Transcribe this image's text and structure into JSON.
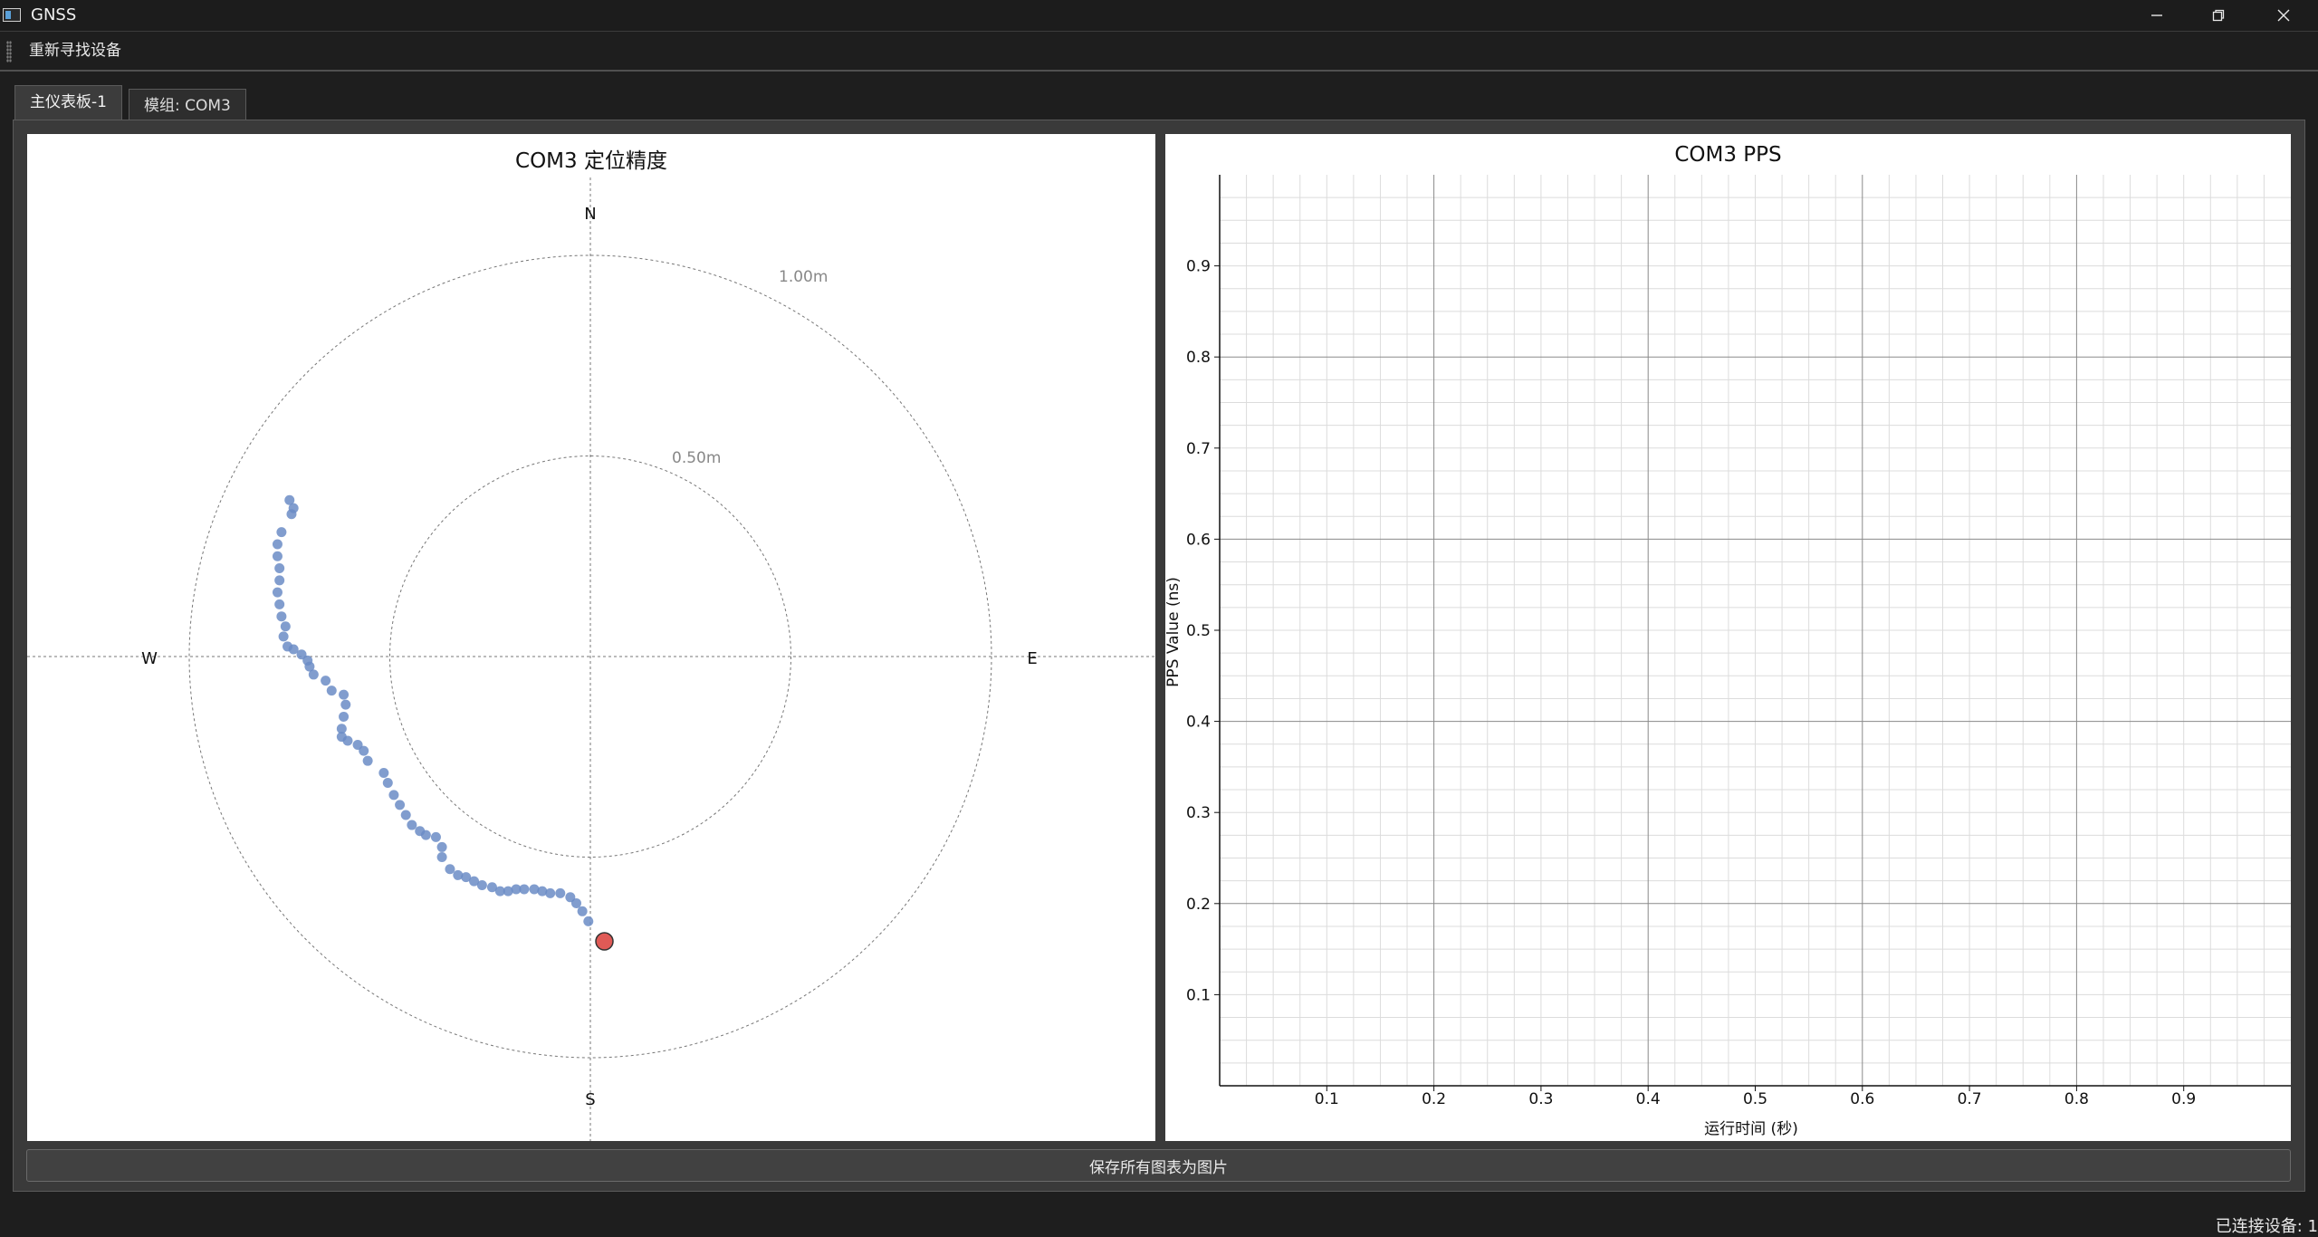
{
  "window": {
    "title": "GNSS"
  },
  "toolbar": {
    "rescan_label": "重新寻找设备"
  },
  "tabs": [
    {
      "label": "主仪表板-1",
      "active": true
    },
    {
      "label": "模组: COM3",
      "active": false
    }
  ],
  "polar_chart": {
    "title": "COM3 定位精度",
    "compass": {
      "n": "N",
      "s": "S",
      "e": "E",
      "w": "W"
    },
    "ring_labels": [
      "0.50m",
      "1.00m"
    ],
    "colors": {
      "track": "#6b8cc5",
      "current": "#e05a56"
    }
  },
  "chart_data": [
    {
      "type": "scatter",
      "title": "COM3 定位精度",
      "units": "m",
      "rings": [
        0.5,
        1.0
      ],
      "ring_labels": [
        "0.50m",
        "1.00m"
      ],
      "points_east_north": [
        [
          -0.75,
          0.39
        ],
        [
          -0.74,
          0.37
        ],
        [
          -0.745,
          0.355
        ],
        [
          -0.77,
          0.31
        ],
        [
          -0.78,
          0.28
        ],
        [
          -0.78,
          0.25
        ],
        [
          -0.775,
          0.22
        ],
        [
          -0.775,
          0.19
        ],
        [
          -0.78,
          0.16
        ],
        [
          -0.775,
          0.13
        ],
        [
          -0.77,
          0.1
        ],
        [
          -0.76,
          0.075
        ],
        [
          -0.765,
          0.05
        ],
        [
          -0.755,
          0.025
        ],
        [
          -0.74,
          0.018
        ],
        [
          -0.72,
          0.005
        ],
        [
          -0.705,
          -0.01
        ],
        [
          -0.7,
          -0.025
        ],
        [
          -0.69,
          -0.045
        ],
        [
          -0.66,
          -0.06
        ],
        [
          -0.645,
          -0.085
        ],
        [
          -0.615,
          -0.095
        ],
        [
          -0.61,
          -0.12
        ],
        [
          -0.615,
          -0.15
        ],
        [
          -0.62,
          -0.18
        ],
        [
          -0.62,
          -0.2
        ],
        [
          -0.605,
          -0.21
        ],
        [
          -0.58,
          -0.22
        ],
        [
          -0.565,
          -0.235
        ],
        [
          -0.555,
          -0.26
        ],
        [
          -0.515,
          -0.29
        ],
        [
          -0.505,
          -0.315
        ],
        [
          -0.49,
          -0.345
        ],
        [
          -0.475,
          -0.37
        ],
        [
          -0.46,
          -0.395
        ],
        [
          -0.445,
          -0.42
        ],
        [
          -0.425,
          -0.435
        ],
        [
          -0.41,
          -0.445
        ],
        [
          -0.385,
          -0.45
        ],
        [
          -0.37,
          -0.475
        ],
        [
          -0.37,
          -0.5
        ],
        [
          -0.35,
          -0.53
        ],
        [
          -0.33,
          -0.545
        ],
        [
          -0.31,
          -0.55
        ],
        [
          -0.29,
          -0.56
        ],
        [
          -0.27,
          -0.57
        ],
        [
          -0.245,
          -0.575
        ],
        [
          -0.225,
          -0.585
        ],
        [
          -0.205,
          -0.585
        ],
        [
          -0.185,
          -0.58
        ],
        [
          -0.165,
          -0.58
        ],
        [
          -0.14,
          -0.58
        ],
        [
          -0.12,
          -0.585
        ],
        [
          -0.1,
          -0.59
        ],
        [
          -0.075,
          -0.59
        ],
        [
          -0.05,
          -0.6
        ],
        [
          -0.035,
          -0.615
        ],
        [
          -0.02,
          -0.635
        ],
        [
          -0.005,
          -0.66
        ]
      ],
      "current": [
        0.035,
        -0.71
      ]
    },
    {
      "type": "line",
      "title": "COM3 PPS",
      "xlabel": "运行时间 (秒)",
      "ylabel": "PPS Value (ns)",
      "xlim": [
        0,
        1
      ],
      "ylim": [
        0,
        1
      ],
      "xticks": [
        "0.1",
        "0.2",
        "0.3",
        "0.4",
        "0.5",
        "0.6",
        "0.7",
        "0.8",
        "0.9"
      ],
      "yticks": [
        "0.1",
        "0.2",
        "0.3",
        "0.4",
        "0.5",
        "0.6",
        "0.7",
        "0.8",
        "0.9"
      ],
      "grid": true,
      "series": []
    }
  ],
  "pps_chart": {
    "title": "COM3 PPS",
    "xlabel": "运行时间 (秒)",
    "ylabel": "PPS Value (ns)",
    "xticks": [
      "0.1",
      "0.2",
      "0.3",
      "0.4",
      "0.5",
      "0.6",
      "0.7",
      "0.8",
      "0.9"
    ],
    "yticks": [
      "0.1",
      "0.2",
      "0.3",
      "0.4",
      "0.5",
      "0.6",
      "0.7",
      "0.8",
      "0.9"
    ]
  },
  "actions": {
    "save_all_label": "保存所有图表为图片"
  },
  "status": {
    "connected_label": "已连接设备: 1"
  }
}
